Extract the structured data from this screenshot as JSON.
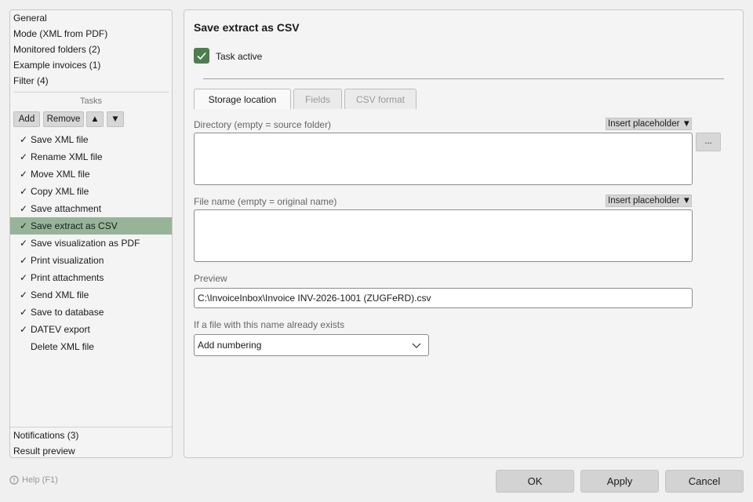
{
  "sidebar": {
    "top_items": [
      {
        "label": "General"
      },
      {
        "label": "Mode (XML from PDF)"
      },
      {
        "label": "Monitored folders (2)"
      },
      {
        "label": "Example invoices (1)"
      },
      {
        "label": "Filter (4)"
      }
    ],
    "tasks_header": "Tasks",
    "buttons": {
      "add": "Add",
      "remove": "Remove",
      "up": "▲",
      "down": "▼"
    },
    "tasks": [
      {
        "check": "✓",
        "label": "Save XML file"
      },
      {
        "check": "✓",
        "label": "Rename XML file"
      },
      {
        "check": "✓",
        "label": "Move XML file"
      },
      {
        "check": "✓",
        "label": "Copy XML file"
      },
      {
        "check": "✓",
        "label": "Save attachment"
      },
      {
        "check": "✓",
        "label": "Save extract as CSV",
        "selected": true
      },
      {
        "check": "✓",
        "label": "Save visualization as PDF"
      },
      {
        "check": "✓",
        "label": "Print visualization"
      },
      {
        "check": "✓",
        "label": "Print attachments"
      },
      {
        "check": "✓",
        "label": "Send XML file"
      },
      {
        "check": "✓",
        "label": "Save to database"
      },
      {
        "check": "✓",
        "label": "DATEV export"
      },
      {
        "check": "",
        "label": "Delete XML file"
      }
    ],
    "bottom_items": [
      {
        "label": "Notifications (3)"
      },
      {
        "label": "Result preview"
      }
    ]
  },
  "main": {
    "title": "Save extract as CSV",
    "task_active_label": "Task active",
    "task_active": true,
    "tabs": [
      {
        "label": "Storage location",
        "active": true
      },
      {
        "label": "Fields",
        "active": false
      },
      {
        "label": "CSV format",
        "active": false
      }
    ],
    "directory_label": "Directory (empty = source folder)",
    "directory_value": "",
    "insert_placeholder": "Insert placeholder ▼",
    "browse_label": "...",
    "filename_label": "File name (empty = original name)",
    "filename_value": "",
    "preview_label": "Preview",
    "preview_value": "C:\\InvoiceInbox\\Invoice INV-2026-1001 (ZUGFeRD).csv",
    "exists_label": "If a file with this name already exists",
    "exists_selected": "Add numbering"
  },
  "footer": {
    "help": "Help (F1)",
    "ok": "OK",
    "apply": "Apply",
    "cancel": "Cancel"
  },
  "colors": {
    "accent": "#4d7e50",
    "selected_row": "#97b499"
  }
}
